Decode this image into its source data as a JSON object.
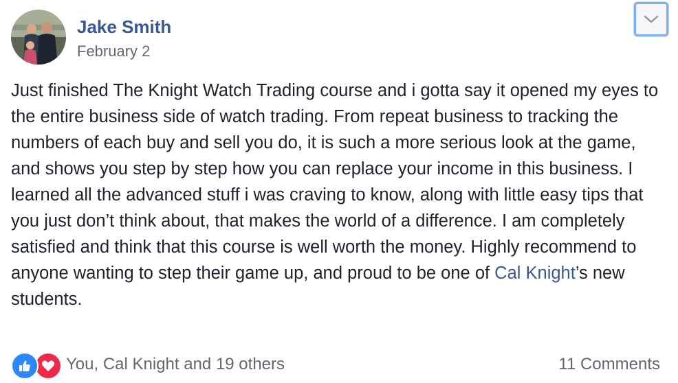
{
  "post": {
    "author": "Jake Smith",
    "date": "February 2",
    "text_before_link": "Just finished The Knight Watch Trading course and i gotta say it opened my eyes to the entire business side of watch trading. From repeat business to tracking the numbers of each buy and sell you do, it is such a more serious look at the game, and shows you step by step how you can replace your income in this business. I learned all the advanced stuff i was craving to know, along with little easy tips that you just don’t think about, that makes the world of a difference. I am completely satisfied and think that this course is well worth the money. Highly recommend to anyone wanting to step their game up, and proud to be one of ",
    "mention": "Cal Knight",
    "text_after_link": "’s new students.",
    "menu_icon": "chevron-down-icon"
  },
  "footer": {
    "reaction_icons": [
      "like-icon",
      "love-icon"
    ],
    "reaction_summary": "You, Cal Knight and 19 others",
    "comments": "11 Comments"
  },
  "colors": {
    "link": "#385898",
    "text": "#1d2129",
    "secondary": "#616770",
    "like": "#2d88ff",
    "love": "#f0284a",
    "focus_ring": "#7fb0ee"
  }
}
